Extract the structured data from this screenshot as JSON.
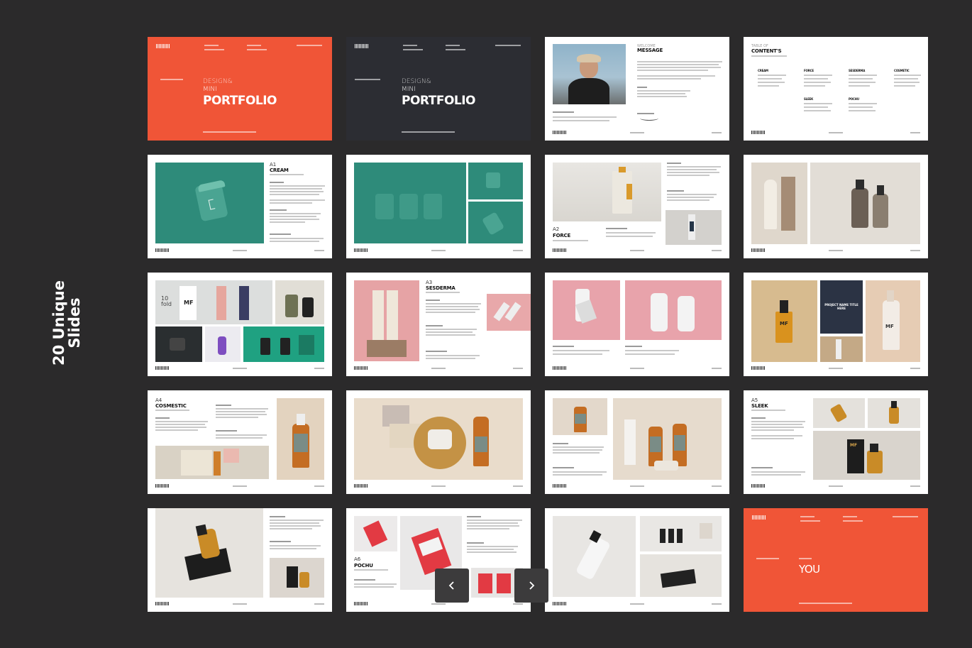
{
  "side_title": {
    "line1": "20 Unique",
    "line2": "Slides"
  },
  "slides": {
    "cover1": {
      "small1": "DESIGN&",
      "small2": "MINI",
      "big": "PORTFOLIO"
    },
    "cover2": {
      "small1": "DESIGN&",
      "small2": "MINI",
      "big": "PORTFOLIO"
    },
    "message": {
      "title": "MESSAGE"
    },
    "contents": {
      "title": "CONTENT'S",
      "items": [
        "CREAM",
        "FORCE",
        "SESDERMA",
        "COSMETIC",
        "SLEEK",
        "POCHU"
      ]
    },
    "cream": {
      "num": "A1",
      "title": "CREAM"
    },
    "force": {
      "num": "A2",
      "title": "FORCE"
    },
    "sesderma": {
      "num": "A3",
      "title": "SESDERMA"
    },
    "cosmestic": {
      "num": "A4",
      "title": "COSMESTIC"
    },
    "sleek": {
      "num": "A5",
      "title": "SLEEK"
    },
    "pochu": {
      "num": "A6",
      "title": "POCHU"
    },
    "thanks": {
      "big": "YOU"
    },
    "tenfold": {
      "l1": "10",
      "l2": "fold"
    },
    "mf_label": "MF",
    "project_box": "PROJECT NAME TITLE HERE"
  },
  "nav": {
    "prev_icon": "chevron-left-icon",
    "next_icon": "chevron-right-icon"
  },
  "colors": {
    "background": "#2b2a2b",
    "accent": "#f05537",
    "dark_slide": "#2c2d33",
    "teal": "#2e8b7a"
  }
}
